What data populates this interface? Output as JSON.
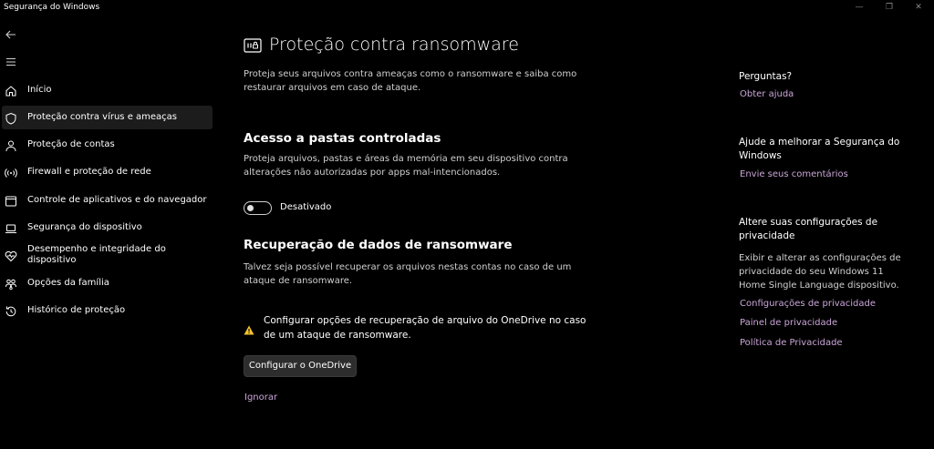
{
  "window": {
    "title": "Segurança do Windows",
    "minimize_glyph": "—",
    "maximize_glyph": "❐",
    "close_glyph": "✕"
  },
  "nav": {
    "back_icon": "back-arrow-icon",
    "menu_icon": "hamburger-menu-icon",
    "items": [
      {
        "label": "Início",
        "icon": "home-icon"
      },
      {
        "label": "Proteção contra vírus e ameaças",
        "icon": "shield-icon",
        "active": true
      },
      {
        "label": "Proteção de contas",
        "icon": "person-icon"
      },
      {
        "label": "Firewall e proteção de rede",
        "icon": "wifi-antenna-icon"
      },
      {
        "label": "Controle de aplicativos e do navegador",
        "icon": "browser-window-icon"
      },
      {
        "label": "Segurança do dispositivo",
        "icon": "laptop-icon"
      },
      {
        "label": "Desempenho e integridade do dispositivo",
        "icon": "heart-pulse-icon"
      },
      {
        "label": "Opções da família",
        "icon": "family-icon"
      },
      {
        "label": "Histórico de proteção",
        "icon": "history-icon"
      }
    ]
  },
  "main": {
    "title": "Proteção contra ransomware",
    "title_icon": "ransomware-folder-icon",
    "description": "Proteja seus arquivos contra ameaças como o ransomware e saiba como restaurar arquivos em caso de ataque.",
    "cfa": {
      "title": "Acesso a pastas controladas",
      "description": "Proteja arquivos, pastas e áreas da memória em seu dispositivo contra alterações não autorizadas por apps mal-intencionados.",
      "toggle_state": "Desativado",
      "toggle_on": false
    },
    "recovery": {
      "title": "Recuperação de dados de ransomware",
      "description": "Talvez seja possível recuperar os arquivos nestas contas no caso de um ataque de ransomware.",
      "warning_icon": "warning-triangle-icon",
      "warning_text": "Configurar opções de recuperação de arquivo do OneDrive no caso de um ataque de ransomware.",
      "button_label": "Configurar o OneDrive",
      "ignore_label": "Ignorar"
    }
  },
  "sidebar": {
    "questions": {
      "title": "Perguntas?",
      "link": "Obter ajuda"
    },
    "improve": {
      "title": "Ajude a melhorar a Segurança do Windows",
      "link": "Envie seus comentários"
    },
    "privacy": {
      "title": "Altere suas configurações de privacidade",
      "text": "Exibir e alterar as configurações de privacidade do seu Windows 11 Home Single Language dispositivo.",
      "links": [
        "Configurações de privacidade",
        "Painel de privacidade",
        "Política de Privacidade"
      ]
    }
  },
  "colors": {
    "background": "#000000",
    "link": "#cba6d9",
    "active_nav": "#1c1c1c",
    "warning": "#f2c12e"
  }
}
